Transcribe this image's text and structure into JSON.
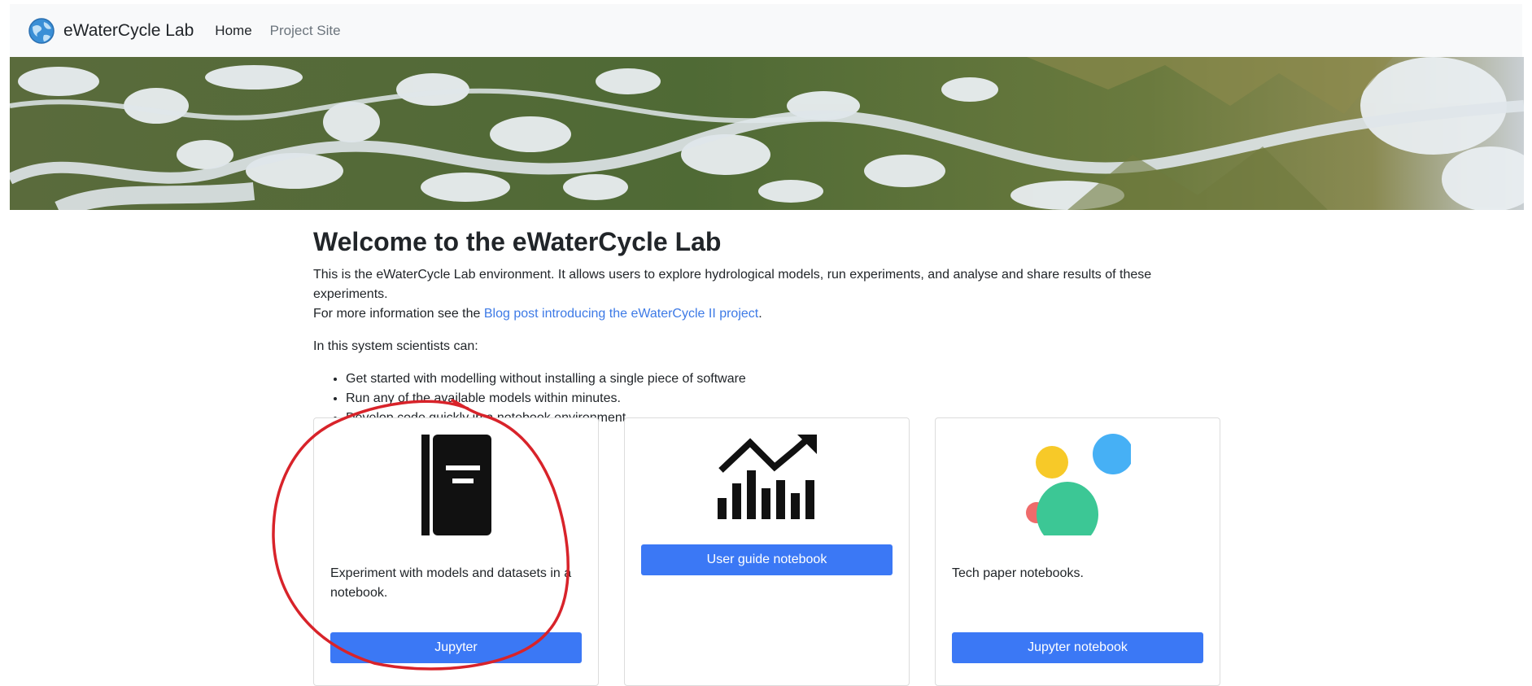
{
  "navbar": {
    "brand": "eWaterCycle Lab",
    "links": [
      {
        "label": "Home"
      },
      {
        "label": "Project Site"
      }
    ]
  },
  "banner": {
    "icon": "aerial-river-landscape-image"
  },
  "main": {
    "title": "Welcome to the eWaterCycle Lab",
    "intro_text": "This is the eWaterCycle Lab environment. It allows users to explore hydrological models, run experiments, and analyse and share results of these experiments.",
    "more_info_prefix": "For more information see the ",
    "more_info_link": "Blog post introducing the eWaterCycle II project",
    "more_info_suffix": ".",
    "capabilities_intro": "In this system scientists can:",
    "capabilities": [
      "Get started with modelling without installing a single piece of software",
      "Run any of the available models within minutes.",
      "Develop code quickly in a notebook environment."
    ]
  },
  "cards": [
    {
      "icon": "notebook-icon",
      "text": "Experiment with models and datasets in a notebook.",
      "button": "Jupyter"
    },
    {
      "icon": "trending-chart-icon",
      "text": "",
      "button": "User guide notebook"
    },
    {
      "icon": "colored-circles-icon",
      "text": "Tech paper notebooks.",
      "button": "Jupyter notebook"
    }
  ],
  "colors": {
    "primary_button": "#3b78f5",
    "link": "#3d7ae6",
    "navbar_bg": "#f8f9fa",
    "annotation": "#d8232a"
  }
}
